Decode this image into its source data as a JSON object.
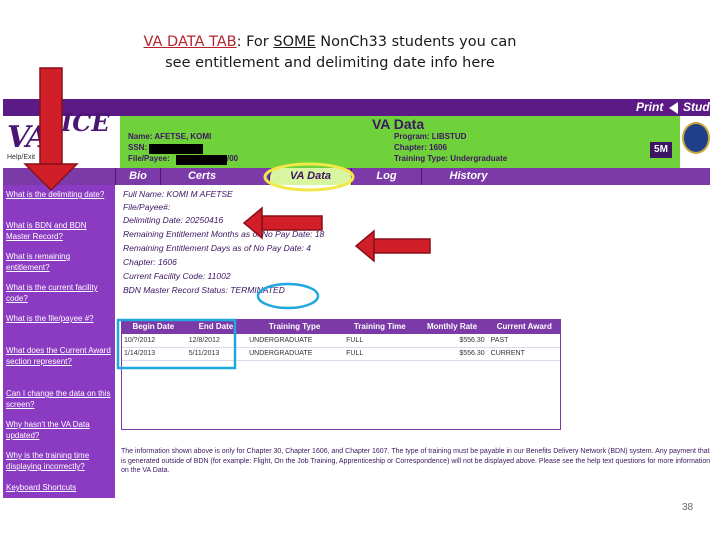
{
  "slide": {
    "title_lead": "VA DATA TAB",
    "title_colon": ":",
    "title_mid": " For ",
    "title_some": "SOME",
    "title_rest": " NonCh33 students you can",
    "title_line2": "see entitlement and delimiting date info here",
    "page_number": "38"
  },
  "topbar": {
    "print": "Print",
    "stud": "Stud"
  },
  "logo": {
    "text_v": "VA",
    "text_ice": "ICE",
    "sub": "Help/Exit"
  },
  "header": {
    "title": "VA Data",
    "name": "Name: AFETSE, KOMI",
    "ssn": "SSN:",
    "file": "File/Payee:",
    "file_suffix": "/00",
    "program": "Program: LIBSTUD",
    "chapter": "Chapter: 1606",
    "training_type": "Training Type: Undergraduate",
    "badge": "5M"
  },
  "tabs": [
    "Bio",
    "Certs",
    "VA Data",
    "Log",
    "History"
  ],
  "sidebar": [
    "What is the delimiting date?",
    "What is BDN and BDN Master Record?",
    "What is remaining entitlement?",
    "What is the current facility code?",
    "What is the file/payee #?",
    "What does the Current Award section represent?",
    "Can I change the data on this screen?",
    "Why hasn't the VA Data updated?",
    "Why is the training time displaying incorrectly?",
    "Keyboard Shortcuts"
  ],
  "fields": {
    "full_name": "Full Name: KOMI M AFETSE",
    "file_payee": "File/Payee#:",
    "delimiting": "Delimiting Date: 20250416",
    "rem_months": "Remaining Entitlement Months as of No Pay Date: 18",
    "rem_days": "Remaining Entitlement Days as of No Pay Date: 4",
    "chapter": "Chapter: 1606",
    "facility": "Current Facility Code: 11002",
    "bdn_status": "BDN Master Record Status: TERMINATED"
  },
  "award_table": {
    "headers": [
      "Begin Date",
      "End Date",
      "Training Type",
      "Training Time",
      "Monthly Rate",
      "Current Award"
    ],
    "rows": [
      [
        "10/?/2012",
        "12/8/2012",
        "UNDERGRADUATE",
        "FULL",
        "$556.30",
        "PAST"
      ],
      [
        "1/14/2013",
        "5/11/2013",
        "UNDERGRADUATE",
        "FULL",
        "$556.30",
        "CURRENT"
      ]
    ]
  },
  "note": "The information shown above is only for Chapter 30, Chapter 1606, and Chapter 1607. The type of training must be payable in our Benefits Delivery Network (BDN) system. Any payment that is generated outside of BDN (for example: Flight, On the Job Training, Apprenticeship or Correspondence) will not be displayed above. Please see the help text questions for more information on the VA Data.",
  "colors": {
    "purple": "#7b3aa8",
    "green": "#6fd23a",
    "arrow_red": "#d11f2a",
    "highlight_yellow": "#f2e84a",
    "highlight_blue": "#1ea7e0"
  }
}
